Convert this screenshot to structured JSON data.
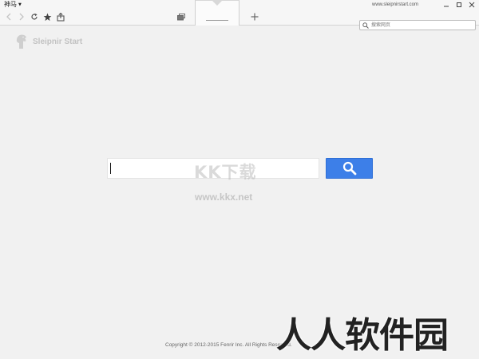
{
  "app": {
    "menu_label": "神马",
    "url": "www.sleipnirstart.com"
  },
  "toolbar": {
    "search_placeholder": "搜索网页"
  },
  "tab": {
    "title": "..."
  },
  "page": {
    "logo_text": "Sleipnir Start",
    "search_value": "",
    "footer": "Copyright © 2012-2015 Fenrir Inc. All Rights Reserved."
  },
  "watermarks": {
    "center": "KK下载",
    "url": "www.kkx.net",
    "bottom": "人人软件园"
  },
  "icons": {
    "back": "back-arrow-icon",
    "forward": "forward-arrow-icon",
    "reload": "reload-icon",
    "bookmark": "star-icon",
    "share": "share-icon",
    "tabs": "tabs-overview-icon",
    "new_tab": "plus-icon",
    "search": "search-icon"
  },
  "colors": {
    "accent": "#3d7fe8",
    "background": "#f1f1f1"
  }
}
